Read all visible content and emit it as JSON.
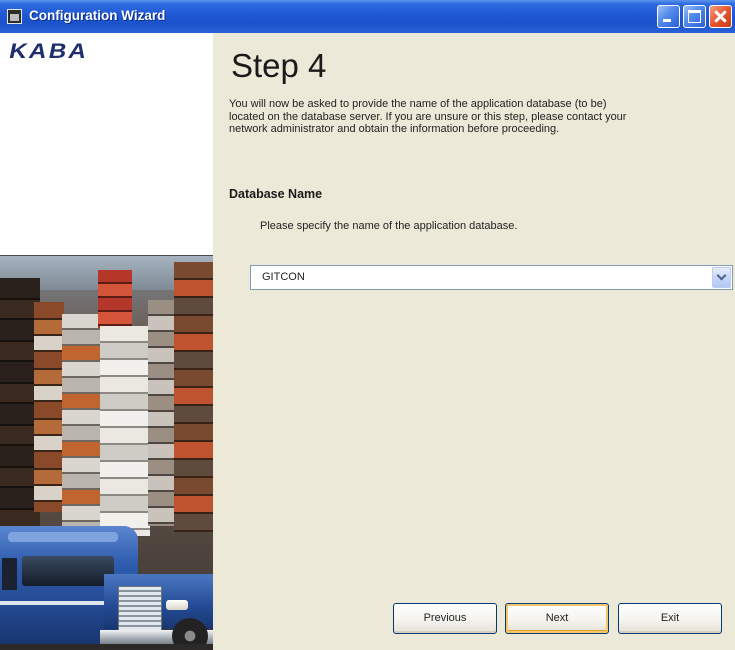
{
  "window": {
    "title": "Configuration Wizard"
  },
  "logo": {
    "text": "KABA"
  },
  "step": {
    "heading": "Step 4",
    "description_lines": [
      "You will now be asked to provide the name of the application database (to be)",
      "located on the database server. If you are unsure or this step, please contact your",
      "network administrator and obtain the information before proceeding."
    ]
  },
  "database": {
    "section_label": "Database Name",
    "instruction": "Please specify the name of the application database.",
    "selected_value": "GITCON"
  },
  "buttons": {
    "previous": "Previous",
    "next": "Next",
    "exit": "Exit"
  },
  "icons": {
    "app": "app-icon",
    "minimize": "minimize-icon",
    "maximize": "maximize-icon",
    "close": "close-icon",
    "dropdown": "chevron-down-icon"
  },
  "colors": {
    "title_bar": "#1F58D4",
    "close_button": "#E5552F",
    "dialog_background": "#ECE9D8",
    "logo": "#1F2F6E",
    "default_button_highlight": "#F7C66A"
  }
}
